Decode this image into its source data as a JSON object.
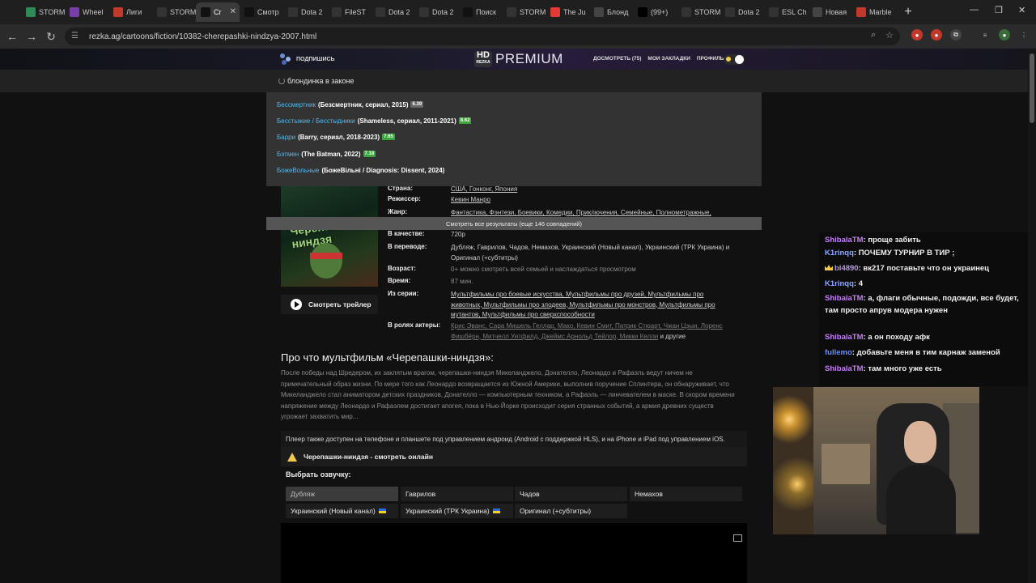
{
  "browser": {
    "tabs": [
      {
        "label": "STORM",
        "fav": "#2e8b57"
      },
      {
        "label": "Wheel",
        "fav": "#7a3ea8"
      },
      {
        "label": "Лиги",
        "fav": "#c0392b"
      },
      {
        "label": "STORM",
        "fav": "#333"
      },
      {
        "label": "Cr",
        "fav": "#111",
        "active": true
      },
      {
        "label": "Смотр",
        "fav": "#111"
      },
      {
        "label": "Dota 2",
        "fav": "#333"
      },
      {
        "label": "FileST",
        "fav": "#333"
      },
      {
        "label": "Dota 2",
        "fav": "#333"
      },
      {
        "label": "Dota 2",
        "fav": "#333"
      },
      {
        "label": "Поиск",
        "fav": "#111"
      },
      {
        "label": "STORM",
        "fav": "#333"
      },
      {
        "label": "The Ju",
        "fav": "#e53935"
      },
      {
        "label": "Блонд",
        "fav": "#444"
      },
      {
        "label": "(99+)",
        "fav": "#000"
      },
      {
        "label": "STORM",
        "fav": "#333"
      },
      {
        "label": "Dota 2",
        "fav": "#333"
      },
      {
        "label": "ESL Ch",
        "fav": "#333"
      },
      {
        "label": "Новая",
        "fav": "#444"
      },
      {
        "label": "Marble",
        "fav": "#c0392b"
      }
    ],
    "url": "rezka.ag/cartoons/fiction/10382-cherepashki-nindzya-2007.html"
  },
  "site": {
    "subscribe": "ПОДПИШИСЬ",
    "logo_hd": "HD",
    "logo_sub": "REZKA",
    "logo_premium": "PREMIUM",
    "nav": {
      "watch": "ДОСМОТРЕТЬ (75)",
      "bookmarks": "МОИ ЗАКЛАДКИ",
      "profile": "ПРОФИЛЬ"
    }
  },
  "search": {
    "query": "блондинка в законе",
    "results": [
      {
        "ru": "Бессмертник",
        "orig": "(Безсмертник, сериал, 2015)",
        "rating": "6.39",
        "low": true
      },
      {
        "ru": "Бесстыжие / Бесстыдники",
        "orig": "(Shameless, сериал, 2011-2021)",
        "rating": "8.62"
      },
      {
        "ru": "Барри",
        "orig": "(Barry, сериал, 2018-2023)",
        "rating": "7.65"
      },
      {
        "ru": "Бэтмен",
        "orig": "(The Batman, 2022)",
        "rating": "7.18"
      },
      {
        "ru": "БожеВольные",
        "orig": "(БожеВільні / Diagnosis: Dissent, 2024)",
        "rating": ""
      }
    ],
    "all_results": "Смотреть все результаты (еще 146 совпадений)"
  },
  "poster": {
    "title": "Черепашки ниндзя"
  },
  "trailer": "Смотреть трейлер",
  "info": {
    "country_label": "Страна:",
    "country": "США, Гонконг, Япония",
    "director_label": "Режиссер:",
    "director": "Кевин Манро",
    "genre_label": "Жанр:",
    "genres": "Фантастика, Фэнтези, Боевики, Комедии, Приключения, Семейные, Полнометражные, Зарубежные",
    "quality_label": "В качестве:",
    "quality": "720p",
    "translation_label": "В переводе:",
    "translation": "Дубляж, Гаврилов, Чадов, Немахов, Украинский (Новый канал), Украинский (ТРК Украина) и Оригинал (+субтитры)",
    "age_label": "Возраст:",
    "age": "0+ можно смотреть всей семьей и наслаждаться просмотром",
    "time_label": "Время:",
    "time": "87 мин.",
    "series_label": "Из серии:",
    "series": "Мультфильмы про боевые искусства, Мультфильмы про друзей, Мультфильмы про животных, Мультфильмы про злодеев, Мультфильмы про монстров, Мультфильмы про мутантов, Мультфильмы про сверхспособности",
    "cast_label": "В ролях актеры:",
    "cast": "Крис Эванс, Сара Мишель Геллар, Мако, Кевин Смит, Патрик Стюарт, Чжан Цзыи, Лоренс Фишбёрн, Митчелл Уитфилд, Джеймс Арнольд Тейлор, Микки Келли",
    "cast_tail": "и другие"
  },
  "about": {
    "title": "Про что мультфильм «Черепашки-ниндзя»:",
    "text": "После победы над Шредером, их заклятым врагом, черепашки-ниндзя Микеланджело, Донателло, Леонардо и Рафаэль ведут ничем не примечательный образ жизни. По мере того как Леонардо возвращается из Южной Америки, выполнив поручение Сплинтера, он обнаруживает, что Микеланджело стал аниматором детских праздников, Донателло — компьютерным техником, а Рафаэль — линчевателем в маске. В скором времени напряжение между Леонардо и Рафаэлем достигает апогея, пока в Нью-Йорке происходит серия странных событий, а армия древних существ угрожает захватить мир..."
  },
  "player": {
    "note": "Плеер также доступен на телефоне и планшете под управлением андроид (Android с поддержкой HLS), и на iPhone и iPad под управлением iOS.",
    "watch_title": "Черепашки-ниндзя - смотреть онлайн",
    "voice_label": "Выбрать озвучку:",
    "voices": [
      "Дубляж",
      "Гаврилов",
      "Чадов",
      "Немахов",
      "Украинский (Новый канал)",
      "Украинский (ТРК Украина)",
      "Оригинал (+субтитры)"
    ]
  },
  "chat": [
    {
      "user": "K1rinqq",
      "text": "ПОЧЕМУ ТУРНИР В ТИР ;",
      "cls": "u2"
    },
    {
      "user": "bl4890",
      "text": "вк217 поставьте что он украинец",
      "cls": "u3",
      "crown": true
    },
    {
      "user": "K1rinqq",
      "text": "4",
      "cls": "u2"
    },
    {
      "user": "ShibalaTM",
      "text": "а, флаги обычные, подожди, все будет, там просто апрув модера нужен",
      "cls": "u1"
    },
    {
      "user": "ShibalaTM",
      "text": "а он походу афк",
      "cls": "u1"
    },
    {
      "user": "fullemo",
      "text": "добавьте меня в тим карнаж заменой",
      "cls": "u4"
    },
    {
      "user": "ShibalaTM",
      "text": "там много уже есть",
      "cls": "u1"
    }
  ],
  "chat_top": {
    "user": "ShibalaTM",
    "text": "проще забить"
  }
}
